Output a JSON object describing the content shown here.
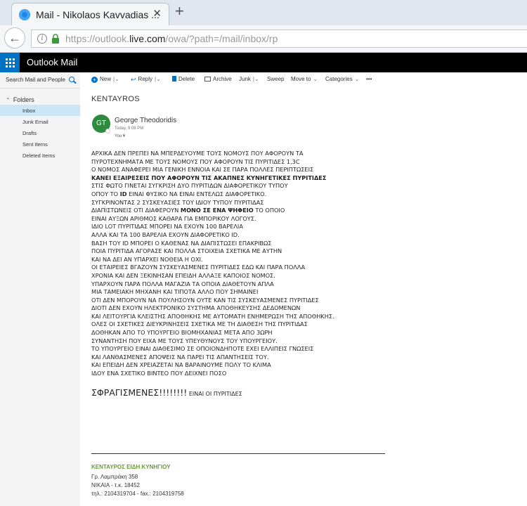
{
  "browser": {
    "tab_title": "Mail - Nikolaos Kavvadias ...",
    "tab_close": "✕",
    "new_tab": "+",
    "url_prefix": "https://outlook.",
    "url_domain": "live.com",
    "url_suffix": "/owa/?path=/mail/inbox/rp"
  },
  "app": {
    "title": "Outlook Mail"
  },
  "sidebar": {
    "search_placeholder": "Search Mail and People",
    "folders_label": "Folders",
    "items": [
      {
        "label": "Inbox",
        "selected": true
      },
      {
        "label": "Junk Email"
      },
      {
        "label": "Drafts"
      },
      {
        "label": "Sent Items"
      },
      {
        "label": "Deleted Items"
      }
    ]
  },
  "toolbar": {
    "new_label": "New",
    "reply_label": "Reply",
    "delete_label": "Delete",
    "archive_label": "Archive",
    "junk_label": "Junk",
    "sweep_label": "Sweep",
    "moveto_label": "Move to",
    "categories_label": "Categories",
    "more_label": "•••"
  },
  "message": {
    "subject": "KENTAYROS",
    "avatar_initials": "GT",
    "sender": "George Theodoridis",
    "sent_time": "Today, 9:08 PM",
    "recipient": "You ¥",
    "body_lines": [
      "ΑΡΧΙΚΑ ΔΕΝ ΠΡΕΠΕΙ ΝΑ ΜΠΕΡΔΕΥΟΥΜΕ ΤΟΥΣ ΝΟΜΟΥΣ ΠΟΥ ΑΦΟΡΟΥΝ ΤΑ",
      "ΠΥΡΟΤΕΧΝΗΜΑΤΑ ΜΕ ΤΟΥΣ ΝΟΜΟΥΣ ΠΟΥ ΑΦΟΡΟΥΝ ΤΙΣ ΠΥΡΙΤΙΔΕΣ 1,3C",
      "Ο ΝΟΜΟΣ ΑΝΑΦΕΡΕΙ ΜΙΑ ΓΕΝΙΚΗ ΕΝΝΟΙΑ ΚΑΙ ΣΕ ΠΑΡΑ ΠΟΛΛΕΣ ΠΕΡΙΠΤΩΣΕΙΣ",
      "ΚΑΝΕΙ ΕΞΑΙΡΕΣΕΙΣ ΠΟΥ ΑΦΟΡΟΥΝ ΤΙΣ ΑΚΑΠΝΕΣ ΚΥΝΗΓΕΤΙΚΕΣ ΠΥΡΙΤΙΔΕΣ",
      "ΣΤΙΣ ΦΩΤΟ ΓΙΝΕΤΑΙ ΣΥΓΚΡΙΣΗ ΔΥΟ ΠΥΡΙΤΙΔΩΝ ΔΙΑΦΟΡΕΤΙΚΟΥ ΤΥΠΟΥ",
      "ΟΠΟΥ ΤΟ ID ΕΙΝΑΙ ΦΥΣΙΚΟ ΝΑ ΕΙΝΑΙ ΕΝΤΕΛΩΣ ΔΙΑΦΟΡΕΤΙΚΟ.",
      "ΣΥΓΚΡΙΝΟΝΤΑΣ 2 ΣΥΣΚΕΥΑΣΙΕΣ ΤΟΥ ΙΔΙΟΥ ΤΥΠΟΥ ΠΥΡΙΤΙΔΑΣ",
      "ΔΙΑΠΙΣΤΩΝΕΙΣ ΟΤΙ ΔΙΑΦΕΡΟΥΝ ΜΟΝΟ ΣΕ ΕΝΑ ΨΗΦΕΙΟ ΤΟ ΟΠΟΙΟ",
      "ΕΙΝΑΙ ΑΥΞΩΝ ΑΡΙΘΜΟΣ ΚΑΘΑΡΑ ΓΙΑ ΕΜΠΟΡΙΚΟΥ ΛΟΓΟΥΣ.",
      "ΙΔΙΟ LOT ΠΥΡΙΤΙΔΑΣ ΜΠΟΡΕΙ ΝΑ ΕΧΟΥΝ 100 ΒΑΡΕΛΙΑ",
      "ΑΛΛΑ ΚΑΙ ΤΑ 100 ΒΑΡΕΛΙΑ ΕΧΟΥΝ ΔΙΑΦΟΡΕΤΙΚΟ ID.",
      "ΒΑΣΗ ΤΟΥ ID ΜΠΟΡΕΙ Ο ΚΑΘΕΝΑΣ ΝΑ ΔΙΑΠΙΣΤΩΣΕΙ ΕΠΑΚΡΙΒΩΣ",
      "ΠΟΙΑ ΠΥΡΙΤΙΔΑ ΑΓΟΡΑΣΕ ΚΑΙ ΠΟΛΛΑ ΣΤΟΙΧΕΙΑ ΣΧΕΤΙΚΑ ΜΕ ΑΥΤΗΝ",
      "ΚΑΙ ΝΑ ΔΕΙ ΑΝ ΥΠΑΡΧΕΙ ΝΟΘΕΙΑ Η ΟΧΙ.",
      "ΟΙ ΕΤΑΙΡΕΙΕΣ ΒΓΑΖΟΥΝ ΣΥΣΚΕΥΑΣΜΕΝΕΣ ΠΥΡΙΤΙΔΕΣ ΕΔΩ ΚΑΙ ΠΑΡΑ ΠΟΛΛΑ",
      "ΧΡΟΝΙΑ ΚΑΙ ΔΕΝ ΞΕΚΙΝΗΣΑΝ ΕΠΕΙΔΗ ΑΛΛΑΞΕ ΚΑΠΟΙΟΣ ΝΟΜΟΣ.",
      "ΥΠΑΡΧΟΥΝ ΠΑΡΑ ΠΟΛΛΑ ΜΑΓΑΖΙΑ ΤΑ ΟΠΟΙΑ ΔΙΑΘΕΤΟΥΝ ΑΠΛΑ",
      "ΜΙΑ ΤΑΜΕΙΑΚΗ ΜΗΧΑΝΗ ΚΑΙ ΤΙΠΟΤΑ ΑΛΛΟ ΠΟΥ ΣΗΜΑΙΝΕΙ",
      "ΟΤΙ ΔΕΝ ΜΠΟΡΟΥΝ ΝΑ ΠΟΥΛΗΣΟΥΝ ΟΥΤΕ ΚΑΝ ΤΙΣ ΣΥΣΚΕΥΑΣΜΕΝΕΣ ΠΥΡΙΤΙΔΕΣ",
      "ΔΙΟΤΙ ΔΕΝ ΕΧΟΥΝ ΗΛΕΚΤΡΟΝΙΚΟ ΣΥΣΤΗΜΑ ΑΠΟΘΗΚΕΥΣΗΣ ΔΕΔΟΜΕΝΩΝ",
      "ΚΑΙ ΛΕΙΤΟΥΡΓΙΑ ΚΛΕΙΣΤΗΣ ΑΠΟΘΗΚΗΣ ΜΕ ΑΥΤΟΜΑΤΗ ΕΝΗΜΕΡΩΣΗ ΤΗΣ ΑΠΟΘΗΚΗΣ.",
      "ΟΛΕΣ ΟΙ ΣΧΕΤΙΚΕΣ ΔΙΕΥΚΡΙΝΗΣΕΙΣ ΣΧΕΤΙΚΑ ΜΕ ΤΗ ΔΙΑΘΕΣΗ ΤΗΣ ΠΥΡΙΤΙΔΑΣ",
      "ΔΟΘΗΚΑΝ ΑΠΟ ΤΟ ΥΠΟΥΡΓΕΙΟ ΒΙΟΜΗΧΑΝΙΑΣ ΜΕΤΑ ΑΠΟ 3ΩΡΗ",
      "ΣΥΝΑΝΤΗΣΗ ΠΟΥ ΕΙΧΑ ΜΕ ΤΟΥΣ ΥΠΕΥΘΥΝΟΥΣ ΤΟΥ ΥΠΟΥΡΓΕΙΟΥ.",
      "ΤΟ ΥΠΟΥΡΓΕΙΟ ΕΙΝΑΙ ΔΙΑΘΕΣΙΜΟ ΣΕ ΟΠΟΙΟΝΔΗΠΟΤΕ ΕΧΕΙ ΕΛΛΙΠΕΙΣ ΓΝΩΣΕΙΣ",
      "ΚΑΙ ΛΑΝΘΑΣΜΕΝΕΣ ΑΠΟΨΕΙΣ ΝΑ ΠΑΡΕΙ ΤΙΣ ΑΠΑΝΤΗΣΕΙΣ ΤΟΥ.",
      "ΚΑΙ ΕΠΕΙΔΗ ΔΕΝ ΧΡΕΙΑΖΕΤΑΙ ΝΑ ΒΑΡΑΙΝΟΥΜΕ ΠΟΛΥ ΤΟ ΚΛΙΜΑ",
      "ΙΔΟΥ ΕΝΑ ΣΧΕΤΙΚΟ ΒΙΝΤΕΟ ΠΟΥ ΔΕΙΧΝΕΙ ΠΟΣΟ"
    ],
    "closing_big": "ΣΦΡΑΓΙΣΜΕΝΕΣ!!!!!!!!",
    "closing_small": " ΕΙΝΑΙ ΟΙ ΠΥΡΙΤΙΔΕΣ"
  },
  "signature": {
    "company": "ΚΕΝΤΑΥΡΟΣ ΕΙΔΗ ΚΥΝΗΓΙΟΥ",
    "address": "Γρ. Λαμπράκη 358",
    "city": "ΝΙΚΑΙΑ  - τ.κ. 18452",
    "phone": "τηλ.: 2104319704 - fax.: 2104319758"
  },
  "colors": {
    "brand": "#0072c6",
    "selected_folder": "#cde6f7",
    "avatar": "#2e8b3e",
    "signature_company": "#6a9a3a"
  }
}
